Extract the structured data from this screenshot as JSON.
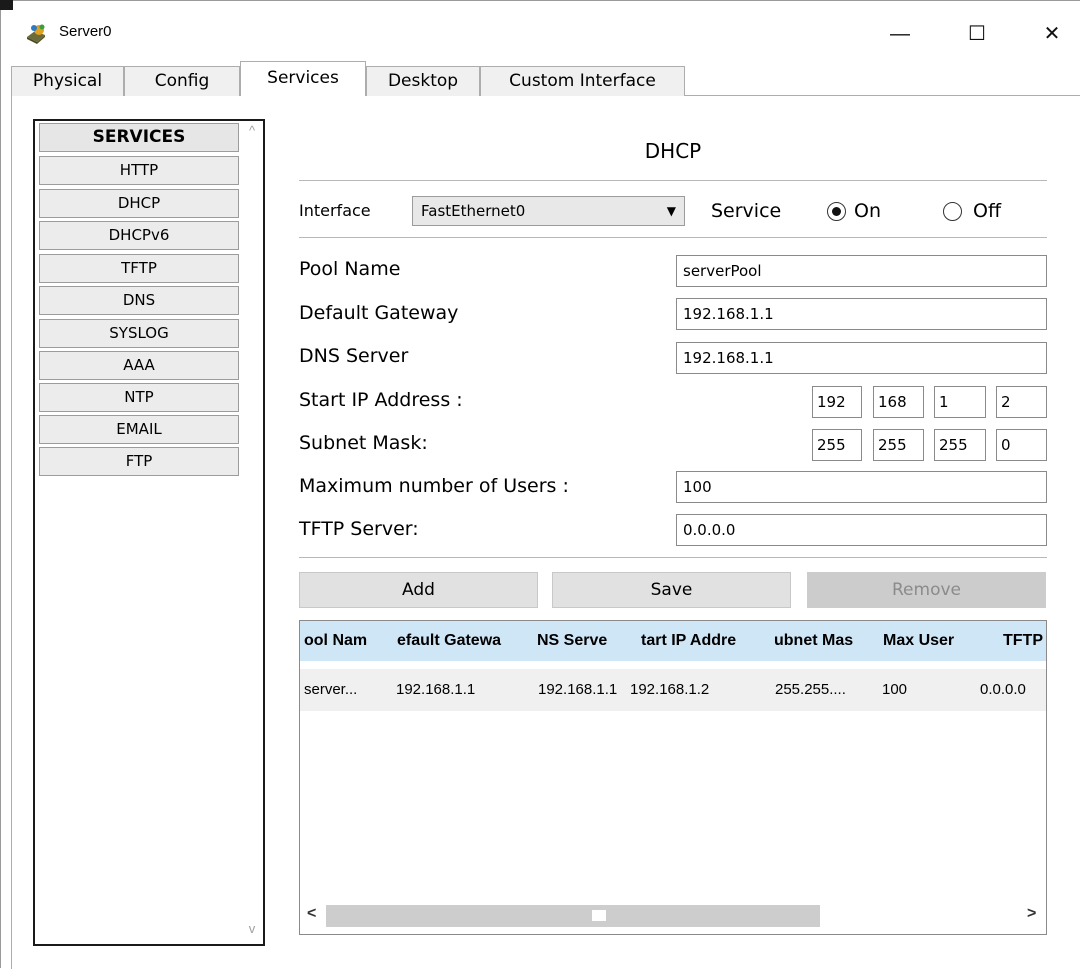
{
  "window": {
    "title": "Server0",
    "minimize_glyph": "—",
    "maximize_glyph": "☐",
    "close_glyph": "✕",
    "app_icon": "server-device-icon"
  },
  "tabs": [
    {
      "label": "Physical",
      "active": false
    },
    {
      "label": "Config",
      "active": false
    },
    {
      "label": "Services",
      "active": true
    },
    {
      "label": "Desktop",
      "active": false
    },
    {
      "label": "Custom Interface",
      "active": false
    }
  ],
  "sidebar": {
    "header": "SERVICES",
    "items": [
      "HTTP",
      "DHCP",
      "DHCPv6",
      "TFTP",
      "DNS",
      "SYSLOG",
      "AAA",
      "NTP",
      "EMAIL",
      "FTP"
    ],
    "scroll_up": "^",
    "scroll_down": "v"
  },
  "dhcp": {
    "title": "DHCP",
    "interface_label": "Interface",
    "interface_value": "FastEthernet0",
    "interface_arrow": "▼",
    "service_label": "Service",
    "on_label": "On",
    "off_label": "Off",
    "service_on": true,
    "pool_name_label": "Pool Name",
    "pool_name": "serverPool",
    "gateway_label": "Default Gateway",
    "gateway": "192.168.1.1",
    "dns_label": "DNS Server",
    "dns": "192.168.1.1",
    "start_ip_label": "Start IP Address :",
    "start_ip": [
      "192",
      "168",
      "1",
      "2"
    ],
    "subnet_label": "Subnet Mask:",
    "subnet": [
      "255",
      "255",
      "255",
      "0"
    ],
    "max_users_label": "Maximum number of Users :",
    "max_users": "100",
    "tftp_label": "TFTP Server:",
    "tftp": "0.0.0.0",
    "add_label": "Add",
    "save_label": "Save",
    "remove_label": "Remove"
  },
  "table": {
    "headers": [
      "ool Nam",
      "efault Gatewa",
      "NS Serve",
      "tart IP Addre",
      "ubnet Mas",
      "Max User",
      "TFTP"
    ],
    "rows": [
      [
        "server...",
        "192.168.1.1",
        "192.168.1.1",
        "192.168.1.2",
        "255.255....",
        "100",
        "0.0.0.0"
      ]
    ],
    "scroll_left": "<",
    "scroll_right": ">"
  }
}
